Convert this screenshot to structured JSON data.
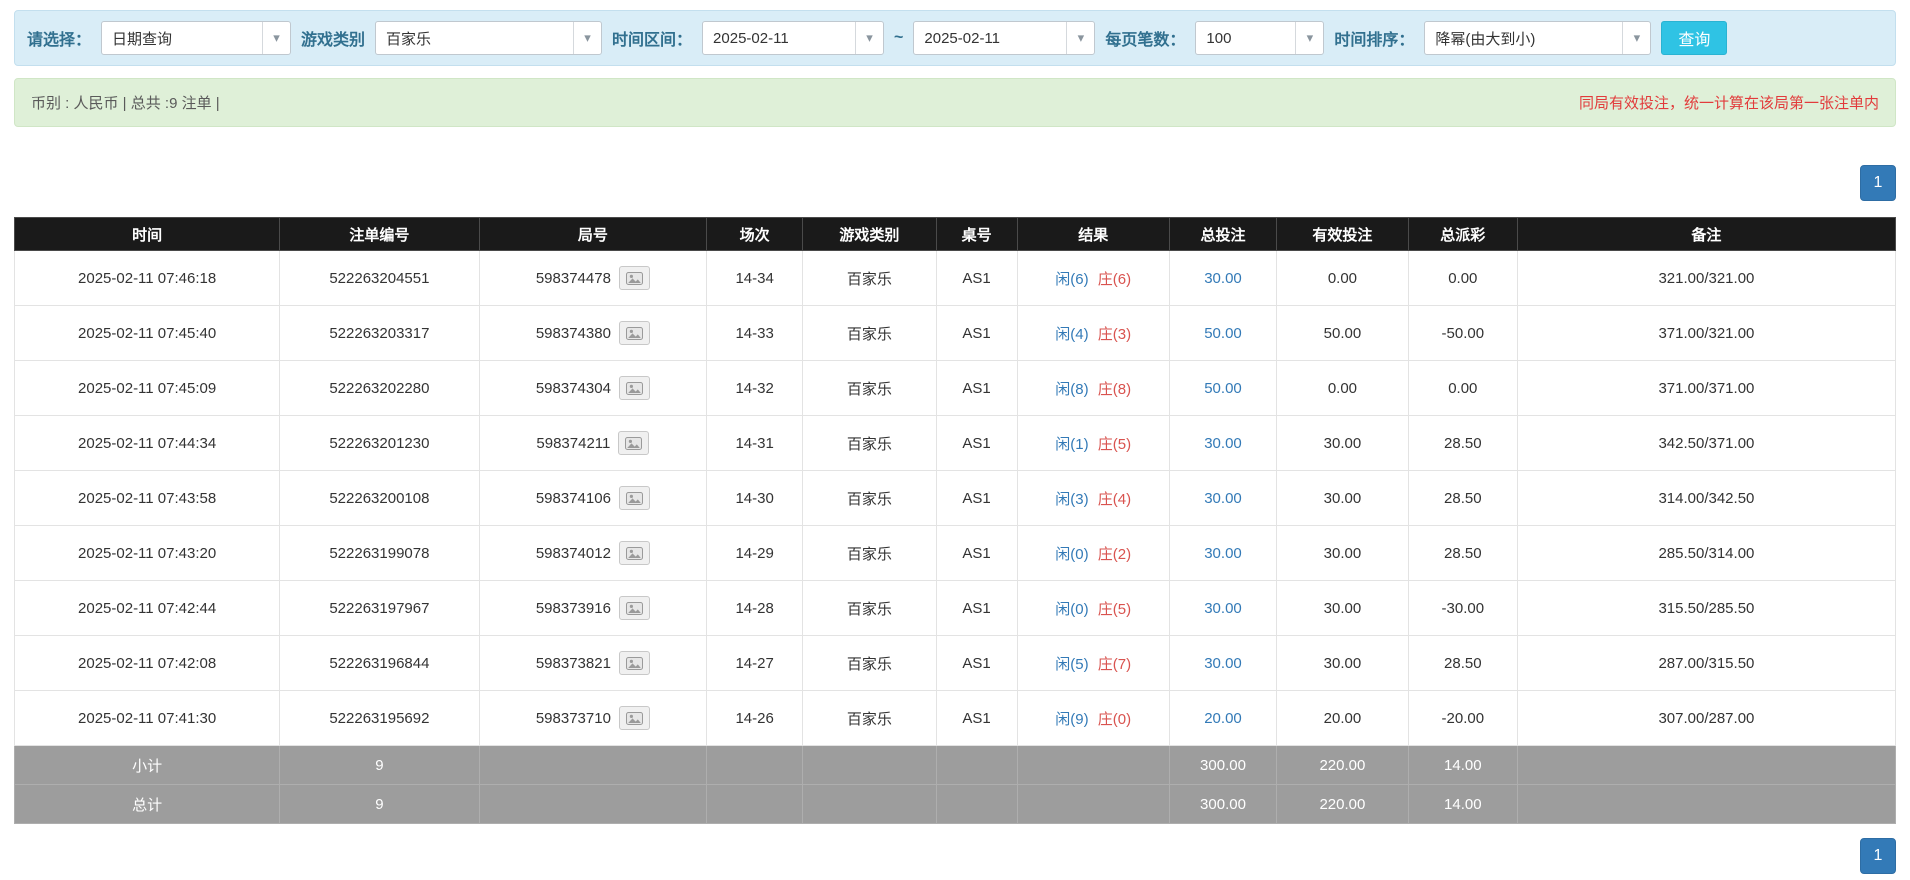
{
  "filter": {
    "select_label": "请选择：",
    "select_value": "日期查询",
    "game_label": "游戏类别",
    "game_value": "百家乐",
    "range_label": "时间区间：",
    "date_from": "2025-02-11",
    "range_separator": "~",
    "date_to": "2025-02-11",
    "page_size_label": "每页笔数：",
    "page_size_value": "100",
    "sort_label": "时间排序：",
    "sort_value": "降幂(由大到小)",
    "query_button": "查询"
  },
  "summary": {
    "currency_info": "币别 : 人民币 | 总共 :9 注单 |",
    "note": "同局有效投注，统一计算在该局第一张注单内"
  },
  "pagination": {
    "current_page": "1"
  },
  "icons": {
    "caret": "▾"
  },
  "colors": {
    "filter_bg": "#d9edf7",
    "summary_bg": "#dff0d8",
    "header_bg": "#1a1a1a",
    "footer_bg": "#9d9d9d",
    "accent_cyan": "#2fc3e4",
    "page_blue": "#337ab7",
    "player_blue": "#337ab7",
    "banker_red": "#d9534f",
    "negative_red": "#e23b3b"
  },
  "table": {
    "headers": [
      "时间",
      "注单编号",
      "局号",
      "场次",
      "游戏类别",
      "桌号",
      "结果",
      "总投注",
      "有效投注",
      "总派彩",
      "备注"
    ],
    "rows": [
      {
        "time": "2025-02-11 07:46:18",
        "bet_no": "522263204551",
        "round_no": "598374478",
        "session": "14-34",
        "game": "百家乐",
        "table_no": "AS1",
        "result_player": "闲(6)",
        "result_banker": "庄(6)",
        "total_bet": "30.00",
        "valid_bet": "0.00",
        "payout": "0.00",
        "remark": "321.00/321.00"
      },
      {
        "time": "2025-02-11 07:45:40",
        "bet_no": "522263203317",
        "round_no": "598374380",
        "session": "14-33",
        "game": "百家乐",
        "table_no": "AS1",
        "result_player": "闲(4)",
        "result_banker": "庄(3)",
        "total_bet": "50.00",
        "valid_bet": "50.00",
        "payout": "-50.00",
        "remark": "371.00/321.00"
      },
      {
        "time": "2025-02-11 07:45:09",
        "bet_no": "522263202280",
        "round_no": "598374304",
        "session": "14-32",
        "game": "百家乐",
        "table_no": "AS1",
        "result_player": "闲(8)",
        "result_banker": "庄(8)",
        "total_bet": "50.00",
        "valid_bet": "0.00",
        "payout": "0.00",
        "remark": "371.00/371.00"
      },
      {
        "time": "2025-02-11 07:44:34",
        "bet_no": "522263201230",
        "round_no": "598374211",
        "session": "14-31",
        "game": "百家乐",
        "table_no": "AS1",
        "result_player": "闲(1)",
        "result_banker": "庄(5)",
        "total_bet": "30.00",
        "valid_bet": "30.00",
        "payout": "28.50",
        "remark": "342.50/371.00"
      },
      {
        "time": "2025-02-11 07:43:58",
        "bet_no": "522263200108",
        "round_no": "598374106",
        "session": "14-30",
        "game": "百家乐",
        "table_no": "AS1",
        "result_player": "闲(3)",
        "result_banker": "庄(4)",
        "total_bet": "30.00",
        "valid_bet": "30.00",
        "payout": "28.50",
        "remark": "314.00/342.50"
      },
      {
        "time": "2025-02-11 07:43:20",
        "bet_no": "522263199078",
        "round_no": "598374012",
        "session": "14-29",
        "game": "百家乐",
        "table_no": "AS1",
        "result_player": "闲(0)",
        "result_banker": "庄(2)",
        "total_bet": "30.00",
        "valid_bet": "30.00",
        "payout": "28.50",
        "remark": "285.50/314.00"
      },
      {
        "time": "2025-02-11 07:42:44",
        "bet_no": "522263197967",
        "round_no": "598373916",
        "session": "14-28",
        "game": "百家乐",
        "table_no": "AS1",
        "result_player": "闲(0)",
        "result_banker": "庄(5)",
        "total_bet": "30.00",
        "valid_bet": "30.00",
        "payout": "-30.00",
        "remark": "315.50/285.50"
      },
      {
        "time": "2025-02-11 07:42:08",
        "bet_no": "522263196844",
        "round_no": "598373821",
        "session": "14-27",
        "game": "百家乐",
        "table_no": "AS1",
        "result_player": "闲(5)",
        "result_banker": "庄(7)",
        "total_bet": "30.00",
        "valid_bet": "30.00",
        "payout": "28.50",
        "remark": "287.00/315.50"
      },
      {
        "time": "2025-02-11 07:41:30",
        "bet_no": "522263195692",
        "round_no": "598373710",
        "session": "14-26",
        "game": "百家乐",
        "table_no": "AS1",
        "result_player": "闲(9)",
        "result_banker": "庄(0)",
        "total_bet": "20.00",
        "valid_bet": "20.00",
        "payout": "-20.00",
        "remark": "307.00/287.00"
      }
    ],
    "subtotal": {
      "label": "小计",
      "count": "9",
      "total_bet": "300.00",
      "valid_bet": "220.00",
      "payout": "14.00"
    },
    "grand_total": {
      "label": "总计",
      "count": "9",
      "total_bet": "300.00",
      "valid_bet": "220.00",
      "payout": "14.00"
    }
  }
}
